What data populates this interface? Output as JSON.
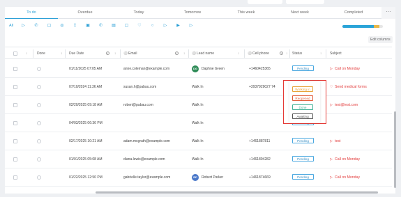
{
  "tabs": [
    {
      "label": "To do",
      "active": true
    },
    {
      "label": "Overdue"
    },
    {
      "label": "Today"
    },
    {
      "label": "Tomorrow"
    },
    {
      "label": "This week"
    },
    {
      "label": "Next week"
    },
    {
      "label": "Completed"
    }
  ],
  "tab_more": "⋯",
  "toolbar": {
    "all_label": "All",
    "icons": [
      "send-icon",
      "phone-icon",
      "chat-icon",
      "users-icon",
      "upload-icon",
      "camera-icon",
      "call-icon",
      "archive-icon",
      "lock-icon",
      "heart-icon",
      "circle-icon",
      "play-icon",
      "play-alt-icon",
      "send-alt-icon"
    ],
    "icon_glyphs": [
      "▷",
      "✆",
      "▢",
      "◎",
      "↥",
      "▣",
      "✆",
      "▤",
      "▢",
      "♡",
      "○",
      "▷",
      "▶",
      "▷"
    ],
    "progress": {
      "blue": 0.78,
      "orange": 0.14
    }
  },
  "edit_columns_label": "Edit columns",
  "columns": {
    "done": "Done",
    "due_date": "Due Date",
    "email": "Email",
    "lead_name": "Lead name",
    "cell_phone": "Cell phone",
    "status": "Status",
    "subject": "Subject"
  },
  "rows": [
    {
      "due": "01/11/2025 07:05 AM",
      "email": "anne.coleman@example.com",
      "lead": "Daphne Green",
      "avatar": "DG",
      "avatar_color": "#2e8b57",
      "phone": "+1460425365",
      "status": "Pending",
      "subject": "Call on Monday",
      "subject_icon": "▷"
    },
    {
      "due": "07/10/2024 11:36 AM",
      "email": "susan.h@pabau.com",
      "lead": "Walk In",
      "avatar": "",
      "phone": "+3937929027 74",
      "status": "",
      "subject": "Send medical forms",
      "subject_icon": "♡"
    },
    {
      "due": "02/20/2025 09:18 AM",
      "email": "robert@pabau.com",
      "lead": "Walk In",
      "avatar": "",
      "phone": "",
      "status": "",
      "subject": "test@test.com",
      "subject_icon": "▷"
    },
    {
      "due": "04/03/2025 06:36 PM",
      "email": "",
      "lead": "Walk In",
      "avatar": "",
      "phone": "",
      "status": "Pending",
      "subject": "",
      "subject_icon": ""
    },
    {
      "due": "02/17/2025 10:21 AM",
      "email": "adam.mcgrath@example.com",
      "lead": "Walk In",
      "avatar": "",
      "phone": "+1461887811",
      "status": "Pending",
      "subject": "test",
      "subject_icon": "▷"
    },
    {
      "due": "01/01/2025 05:08 AM",
      "email": "diana.lewis@example.com",
      "lead": "Walk In",
      "avatar": "",
      "phone": "+1461894282",
      "status": "Pending",
      "subject": "Call on Monday",
      "subject_icon": "▷"
    },
    {
      "due": "01/22/2025 12:50 PM",
      "email": "gabrielle.taylor@example.com",
      "lead": "Robert Parker",
      "avatar": "RP",
      "avatar_color": "#4a78c9",
      "phone": "+1461874669",
      "status": "Pending",
      "subject": "Call on Monday",
      "subject_icon": "▷"
    }
  ],
  "status_dropdown": {
    "options": [
      {
        "label": "Working in",
        "color": "#e8a33a"
      },
      {
        "label": "Reopened",
        "color": "#e25c3a"
      },
      {
        "label": "Done",
        "color": "#45b49a"
      },
      {
        "label": "Awaiting",
        "color": "#555555"
      }
    ]
  },
  "colors": {
    "accent": "#2a9fd6",
    "subject": "#e23b3b",
    "highlight": "#e53935"
  }
}
